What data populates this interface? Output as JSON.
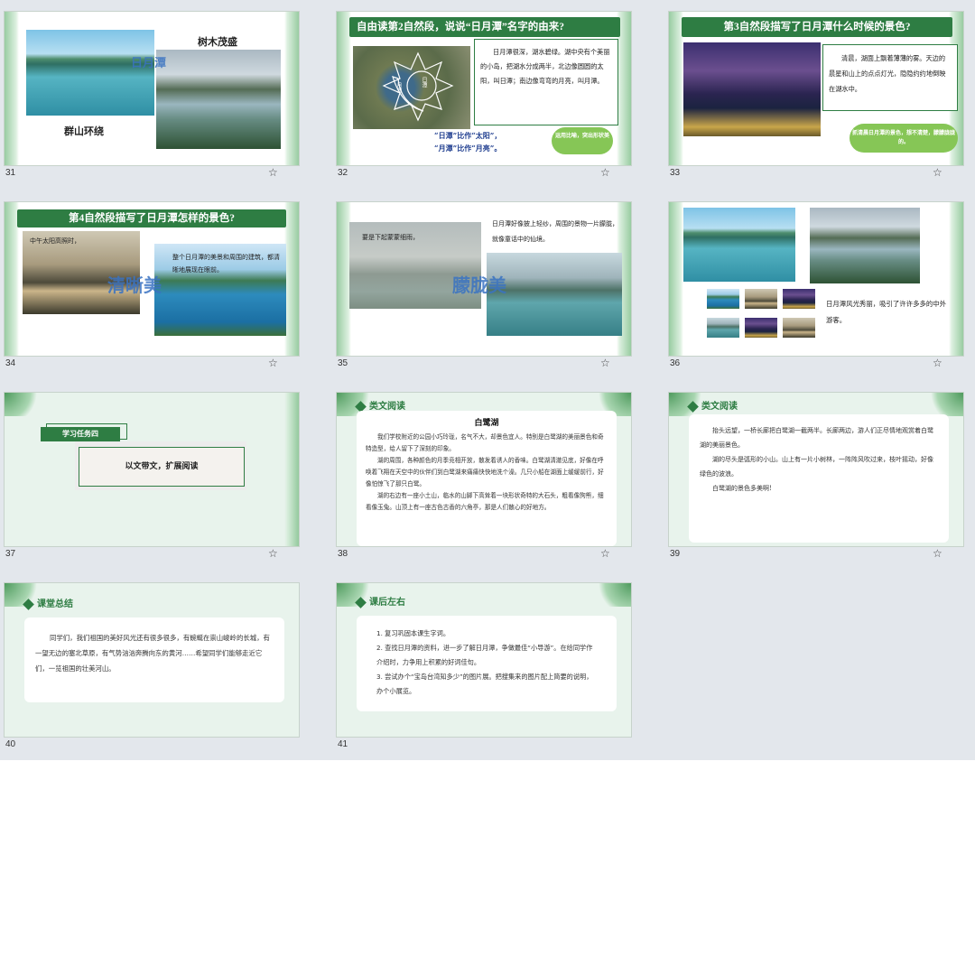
{
  "slides": [
    {
      "number": "31",
      "labels": {
        "tree": "树木茂盛",
        "mountain": "群山环绕",
        "overlay": "日月潭"
      }
    },
    {
      "number": "32",
      "header": "自由读第2自然段，说说“日月潭”名字的由来?",
      "diagram": {
        "left": "月潭",
        "right": "日潭"
      },
      "text": "日月潭很深，湖水碧绿。湖中央有个美丽的小岛，把湖水分成两半，北边像圆圆的太阳，叫日潭；南边像弯弯的月亮，叫月潭。",
      "note1": "“日潭”比作“太阳”，",
      "note2": "“月潭”比作“月亮”。",
      "cloud": "运用比喻，突出形状美"
    },
    {
      "number": "33",
      "header": "第3自然段描写了日月潭什么时候的景色?",
      "text": "清晨，湖面上飘着薄薄的雾。天边的晨星和山上的点点灯光，隐隐约约地倒映在湖水中。",
      "cloud": "抓清晨日月潭的景色，想不清楚，朦朦胧胧的。"
    },
    {
      "number": "34",
      "header": "第4自然段描写了日月潭怎样的景色?",
      "caption1": "中午太阳高照时，",
      "caption2": "整个日月潭的美景和周围的建筑，都清晰地展现在眼前。",
      "overlay": "清晰美"
    },
    {
      "number": "35",
      "caption1": "要是下起蒙蒙细雨，",
      "caption2": "日月潭好像披上轻纱，周围的景物一片朦胧，就像童话中的仙境。",
      "overlay": "朦胧美"
    },
    {
      "number": "36",
      "caption": "日月潭风光秀丽，吸引了许许多多的中外游客。"
    },
    {
      "number": "37",
      "tag": "学习任务四",
      "title": "以文带文，扩展阅读"
    },
    {
      "number": "38",
      "section": "类文阅读",
      "title": "白鹭湖",
      "paragraphs": [
        "我们学校附近的公园小巧玲珑，名气不大，却景色宜人。特别是白鹭湖的美丽景色和奇特造型，给人留下了深刻的印象。",
        "湖的周围，各种颜色的月季竞相开放，散发着诱人的香味。白鹭湖清澈见底，好像在呼唤着飞翔在天空中的伙伴们到白鹭湖来痛痛快快地洗个澡。几只小船在湖面上缓缓前行，好像怕惊飞了那只白鹭。",
        "湖的右边有一座小土山，临水的山脚下高耸着一块形状奇特的大石头，粗看像狗熊，细看像玉兔。山顶上有一座古色古香的六角亭，那是人们散心的好地方。"
      ]
    },
    {
      "number": "39",
      "section": "类文阅读",
      "paragraphs": [
        "抬头远望，一桥长廊把白鹭湖一截两半。长廊两边，游人们正尽情地观赏着白鹭湖的美丽景色。",
        "湖的尽头是弧形的小山。山上有一片小树林，一阵阵风吹过来，枝叶摇动，好像绿色的波浪。",
        "白鹭湖的景色多美啊!"
      ]
    },
    {
      "number": "40",
      "section": "课堂总结",
      "text": "同学们，我们祖国的美好风光还有很多很多，有蜿蜒在崇山峻岭的长城，有一望无边的塞北草原，有气势汹汹奔腾向东的黄河……希望同学们能够走近它们，一览祖国的壮美河山。"
    },
    {
      "number": "41",
      "section": "课后左右",
      "items": [
        "1. 复习巩固本课生字词。",
        "2. 查找日月潭的资料，进一步了解日月潭，争做最佳“小导游”。在给同学作介绍时，力争用上积累的好词佳句。",
        "3. 尝试办个“宝岛台湾知多少”的图片展。把搜集来的图片配上简要的说明，办个小展览。"
      ]
    }
  ],
  "colors": {
    "banner": "#2e7d43",
    "sorter_bg": "#e3e7ec",
    "slide_bg": "#e8f3ec",
    "cloud": "#86c656",
    "overlay": "#3a73c2"
  },
  "icons": {
    "star": "star-outline-icon"
  },
  "star_glyph": "☆"
}
